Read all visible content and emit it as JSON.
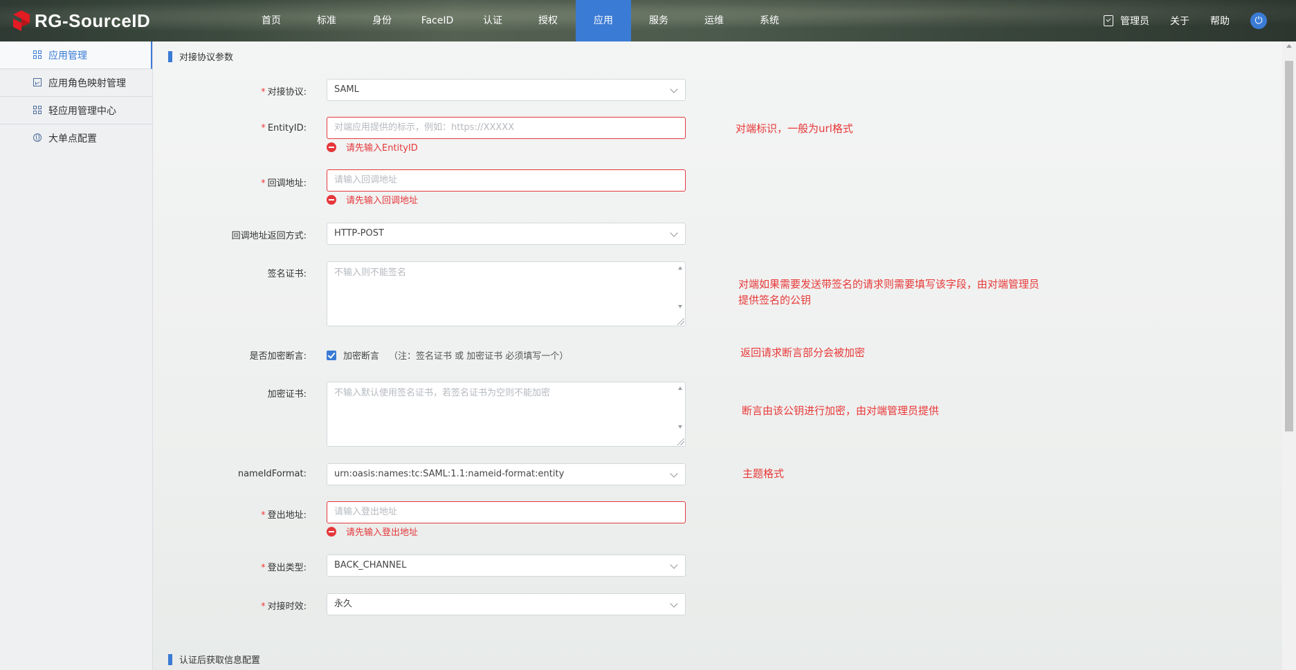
{
  "header": {
    "logo_text": "RG-SourceID",
    "nav": [
      "首页",
      "标准",
      "身份",
      "FaceID",
      "认证",
      "授权",
      "应用",
      "服务",
      "运维",
      "系统"
    ],
    "active_nav": "应用",
    "admin_label": "管理员",
    "about_label": "关于",
    "help_label": "帮助"
  },
  "sidebar": {
    "items": [
      {
        "label": "应用管理",
        "icon": "grid-icon",
        "active": true
      },
      {
        "label": "应用角色映射管理",
        "icon": "chart-icon",
        "active": false
      },
      {
        "label": "轻应用管理中心",
        "icon": "grid-icon",
        "active": false
      },
      {
        "label": "大单点配置",
        "icon": "globe-icon",
        "active": false
      }
    ]
  },
  "sections": {
    "protocol_params": "对接协议参数",
    "after_auth": "认证后获取信息配置"
  },
  "form": {
    "protocol": {
      "label": "对接协议:",
      "value": "SAML",
      "required": true
    },
    "entity_id": {
      "label": "EntityID:",
      "placeholder": "对端应用提供的标示，例如：https://XXXXX",
      "error": "请先输入EntityID",
      "required": true
    },
    "callback": {
      "label": "回调地址:",
      "placeholder": "请输入回调地址",
      "error": "请先输入回调地址",
      "required": true
    },
    "callback_method": {
      "label": "回调地址返回方式:",
      "value": "HTTP-POST"
    },
    "sign_cert": {
      "label": "签名证书:",
      "placeholder": "不输入则不能签名"
    },
    "encrypt_assertion": {
      "label": "是否加密断言:",
      "checkbox_label": "加密断言",
      "note": "（注：签名证书 或 加密证书 必须填写一个）",
      "checked": true
    },
    "encrypt_cert": {
      "label": "加密证书:",
      "placeholder": "不输入默认使用签名证书，若签名证书为空则不能加密"
    },
    "nameid_format": {
      "label": "nameIdFormat:",
      "value": "urn:oasis:names:tc:SAML:1.1:nameid-format:entity"
    },
    "logout_url": {
      "label": "登出地址:",
      "placeholder": "请输入登出地址",
      "error": "请先输入登出地址",
      "required": true
    },
    "logout_type": {
      "label": "登出类型:",
      "value": "BACK_CHANNEL",
      "required": true
    },
    "validity": {
      "label": "对接时效:",
      "value": "永久",
      "required": true
    }
  },
  "annotations": {
    "entity_id": "对端标识，一般为url格式",
    "sign_cert_1": "对端如果需要发送带签名的请求则需要填写该字段，由对端管理员",
    "sign_cert_2": "提供签名的公钥",
    "encrypt_assertion": "返回请求断言部分会被加密",
    "encrypt_cert": "断言由该公钥进行加密，由对端管理员提供",
    "nameid_format": "主题格式"
  },
  "colors": {
    "accent": "#3a7bd5",
    "error": "#e5373b",
    "annotation": "#e83838"
  }
}
